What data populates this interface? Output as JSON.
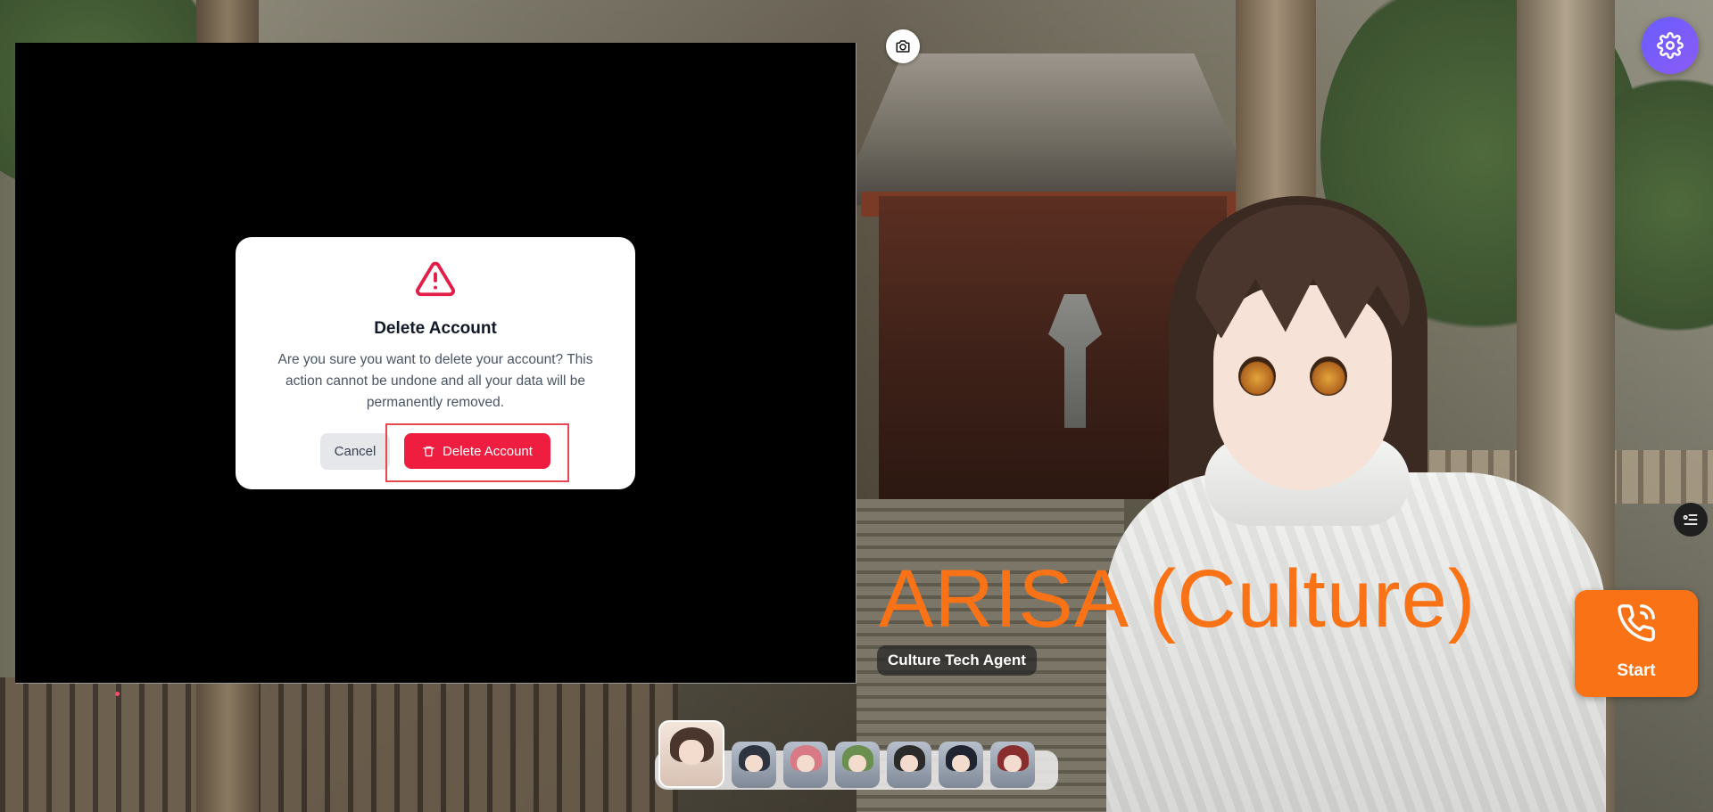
{
  "dialog": {
    "title": "Delete Account",
    "message": "Are you sure you want to delete your account? This action cannot be undone and all your data will be permanently removed.",
    "cancel_label": "Cancel",
    "delete_label": "Delete Account",
    "icon": "warning-triangle-icon"
  },
  "agent": {
    "name": "ARISA (Culture)",
    "subtitle": "Culture Tech Agent"
  },
  "call": {
    "start_label": "Start",
    "icon": "phone-icon"
  },
  "toolbar": {
    "settings_icon": "gear-icon",
    "camera_icon": "camera-icon",
    "side_icon": "list-settings-icon"
  },
  "avatars": [
    {
      "name": "arisa",
      "active": true,
      "hair": "#4a362c"
    },
    {
      "name": "agent-2",
      "active": false,
      "hair": "#2d3440"
    },
    {
      "name": "agent-3",
      "active": false,
      "hair": "#d77a86"
    },
    {
      "name": "agent-4",
      "active": false,
      "hair": "#6b8f4e"
    },
    {
      "name": "agent-5",
      "active": false,
      "hair": "#2b2b2b"
    },
    {
      "name": "agent-6",
      "active": false,
      "hair": "#1f2430"
    },
    {
      "name": "agent-7",
      "active": false,
      "hair": "#8a2d2d"
    }
  ],
  "colors": {
    "accent": "#f97316",
    "danger": "#ef1d3f",
    "settings": "#7c5cff"
  }
}
